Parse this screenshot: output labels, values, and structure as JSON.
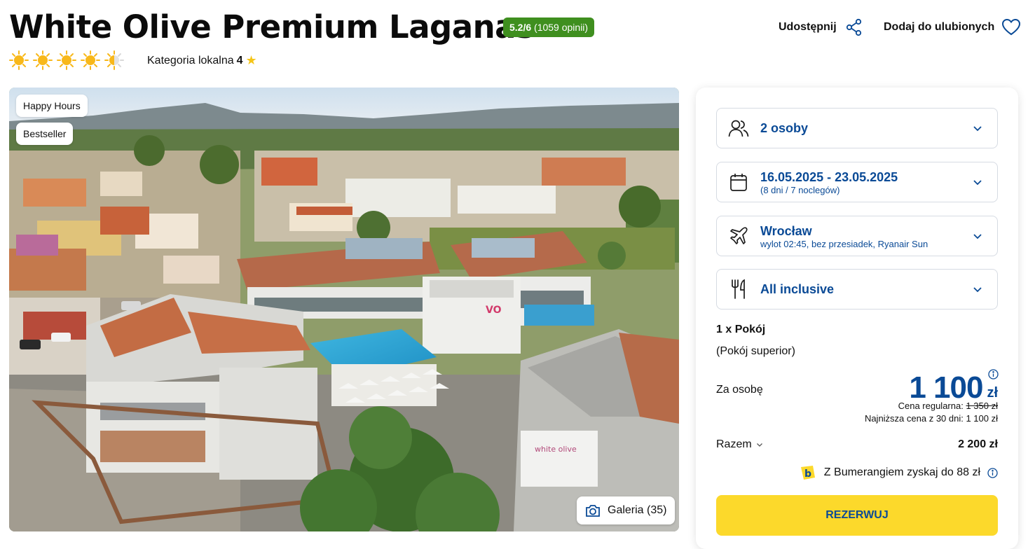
{
  "hotel": {
    "title": "White Olive Premium Laganas",
    "rating_score": "5.2/6",
    "rating_count": "(1059 opinii)",
    "stars": 4.5,
    "local_category_label": "Kategoria lokalna",
    "local_category_value": "4"
  },
  "actions": {
    "share_label": "Udostępnij",
    "favorite_label": "Dodaj do ulubionych"
  },
  "gallery": {
    "tags": [
      "Happy Hours",
      "Bestseller"
    ],
    "button_label": "Galeria (35)"
  },
  "booking": {
    "guests": "2 osoby",
    "dates": "16.05.2025 - 23.05.2025",
    "dates_sub": "(8 dni / 7 noclegów)",
    "departure_city": "Wrocław",
    "departure_sub": "wylot 02:45, bez przesiadek, Ryanair Sun",
    "board": "All inclusive",
    "room_count": "1 x Pokój",
    "room_type": "(Pokój superior)",
    "per_person_label": "Za osobę",
    "price": "1 100",
    "currency": "zł",
    "regular_label": "Cena regularna:",
    "regular_price": "1 350 zł",
    "lowest_label": "Najniższa cena z 30 dni: 1 100 zł",
    "total_label": "Razem",
    "total_value": "2 200 zł",
    "bumerang_text": "Z Bumerangiem zyskaj do 88 zł",
    "book_label": "REZERWUJ"
  },
  "colors": {
    "brand_blue": "#0a4a96",
    "rating_green": "#3f8f1f",
    "cta_yellow": "#fcd92b",
    "sun_yellow": "#f8b81a"
  }
}
